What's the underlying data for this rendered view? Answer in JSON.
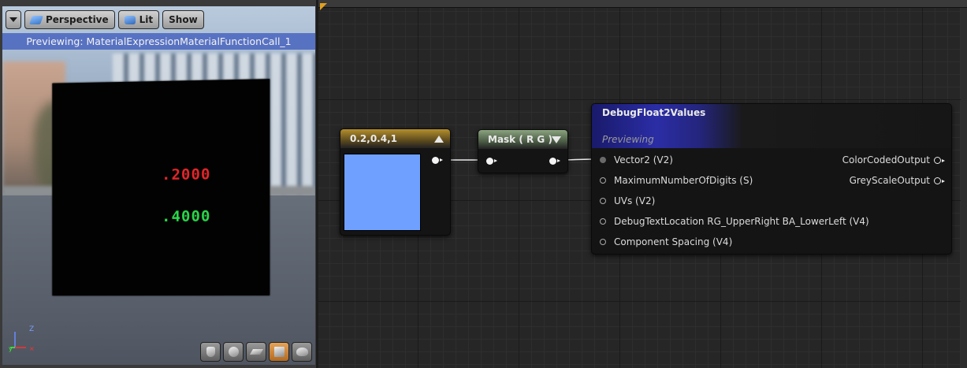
{
  "viewport": {
    "toolbar": {
      "view_mode_label": "Perspective",
      "lit_label": "Lit",
      "show_label": "Show"
    },
    "caption": "Previewing: MaterialExpressionMaterialFunctionCall_1",
    "preview": {
      "red_value": ".2000",
      "green_value": ".4000"
    },
    "axes": {
      "z": "Z"
    },
    "preview_shapes": [
      "cylinder",
      "sphere",
      "plane",
      "cube",
      "teapot"
    ],
    "active_shape": "cube"
  },
  "graph": {
    "const_node": {
      "title": "0.2,0.4,1",
      "color": "#6fa0ff"
    },
    "mask_node": {
      "title": "Mask ( R G )"
    },
    "debug_node": {
      "title": "DebugFloat2Values",
      "subtitle": "Previewing",
      "inputs": [
        "Vector2 (V2)",
        "MaximumNumberOfDigits (S)",
        "UVs (V2)",
        "DebugTextLocation RG_UpperRight BA_LowerLeft (V4)",
        "Component Spacing (V4)"
      ],
      "outputs": [
        "ColorCodedOutput",
        "GreyScaleOutput"
      ]
    }
  },
  "colors": {
    "red_digits": "#e3262a",
    "green_digits": "#2ad74a",
    "caption_bar": "#405cbe",
    "const_header": "#b48f2d",
    "mask_header": "#8aa37f",
    "debug_header": "#2b2da6"
  }
}
